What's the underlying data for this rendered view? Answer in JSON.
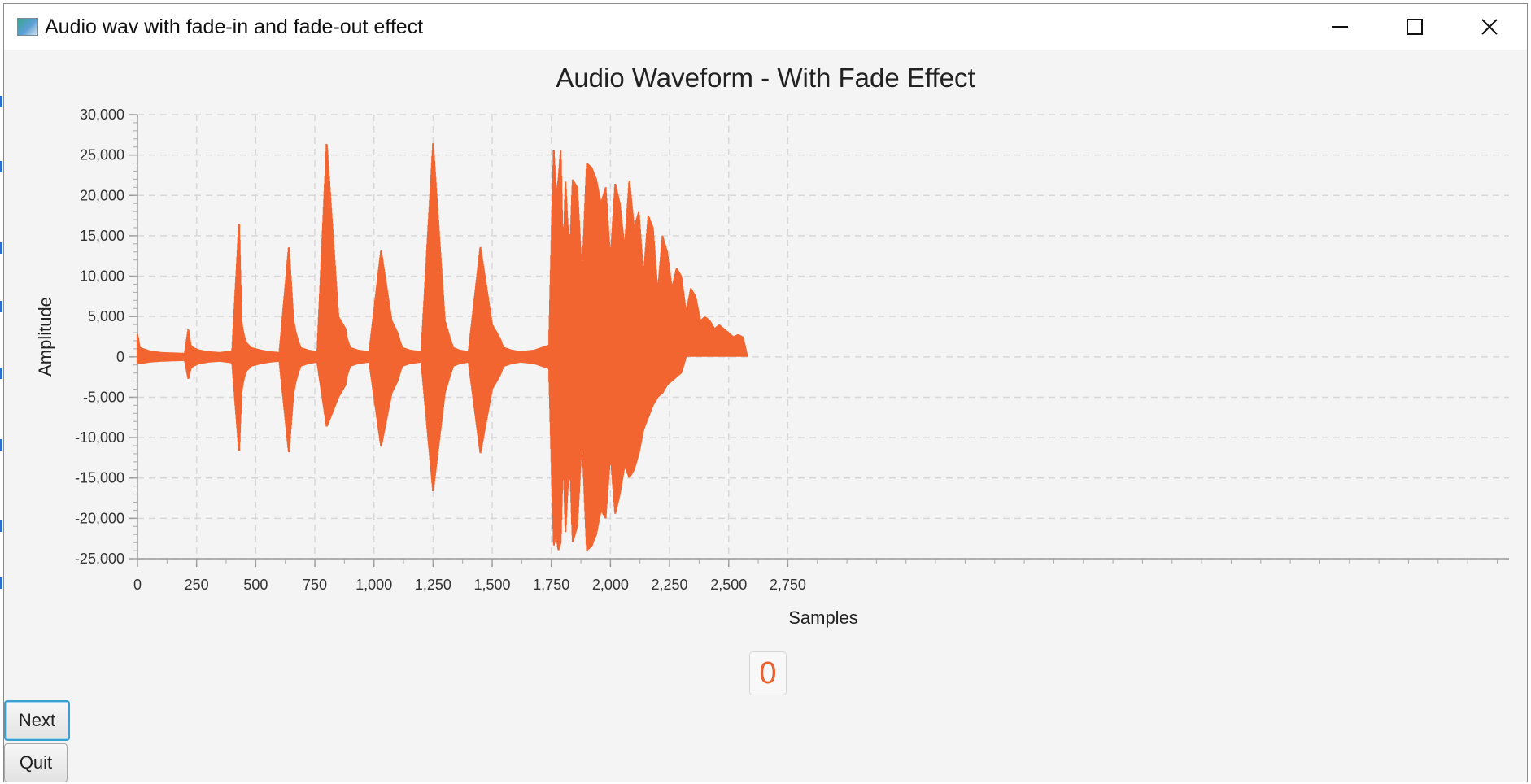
{
  "window": {
    "title": "Audio wav with fade-in and fade-out effect",
    "controls": [
      "minimize-icon",
      "maximize-icon",
      "close-icon"
    ]
  },
  "chart_data": {
    "type": "line",
    "title": "Audio Waveform - With Fade Effect",
    "xlabel": "Samples",
    "ylabel": "Amplitude",
    "xlim": [
      0,
      5800
    ],
    "ylim": [
      -25000,
      30000
    ],
    "x_ticks": [
      "0",
      "250",
      "500",
      "750",
      "1,000",
      "1,250",
      "1,500",
      "1,750",
      "2,000",
      "2,250",
      "2,500",
      "2,750"
    ],
    "y_ticks": [
      "30,000",
      "25,000",
      "20,000",
      "15,000",
      "10,000",
      "5,000",
      "0",
      "-5,000",
      "-10,000",
      "-15,000",
      "-20,000",
      "-25,000"
    ],
    "grid": true,
    "series_color": "#f26430",
    "series": [
      {
        "x": [
          0,
          10,
          50,
          100,
          200,
          215,
          225,
          235,
          260,
          300,
          350,
          400,
          430,
          440,
          445,
          452,
          460,
          480,
          520,
          560,
          600,
          640,
          660,
          670,
          675,
          682,
          690,
          720,
          760,
          800,
          850,
          880,
          885,
          892,
          900,
          930,
          980,
          1030,
          1075,
          1100,
          1105,
          1112,
          1120,
          1150,
          1200,
          1250,
          1300,
          1310,
          1320,
          1328,
          1335,
          1360,
          1400,
          1450,
          1500,
          1520,
          1535,
          1542,
          1550,
          1580,
          1620,
          1680,
          1740,
          1760,
          1770,
          1780,
          1790,
          1800,
          1810,
          1820,
          1830,
          1840,
          1860,
          1880,
          1900,
          1920,
          1940,
          1960,
          1980,
          2000,
          2020,
          2040,
          2060,
          2080,
          2100,
          2120,
          2140,
          2160,
          2180,
          2200,
          2220,
          2240,
          2260,
          2280,
          2300,
          2320,
          2340,
          2360,
          2380,
          2400,
          2420,
          2440,
          2460,
          2480,
          2500,
          2520,
          2540,
          2560,
          2580,
          2600,
          2620,
          2640,
          2650,
          2660,
          2700,
          3000,
          4000,
          5000,
          5800
        ],
        "ymax": [
          2800,
          1200,
          800,
          600,
          500,
          3500,
          1500,
          1200,
          900,
          700,
          600,
          800,
          17000,
          4500,
          3500,
          2500,
          1800,
          1200,
          900,
          700,
          600,
          13800,
          4500,
          3000,
          2500,
          1800,
          1200,
          900,
          700,
          26700,
          5000,
          3500,
          2500,
          1800,
          1200,
          900,
          700,
          13300,
          4500,
          3000,
          2500,
          1800,
          1200,
          900,
          700,
          26700,
          4500,
          3500,
          2500,
          1800,
          1200,
          900,
          700,
          13700,
          4000,
          3000,
          2200,
          1600,
          1200,
          900,
          700,
          900,
          1500,
          26200,
          20000,
          22000,
          25800,
          12000,
          22000,
          16000,
          14000,
          22000,
          21000,
          10000,
          24000,
          23500,
          22000,
          19000,
          21000,
          12000,
          21500,
          19000,
          13500,
          22000,
          16000,
          18000,
          10000,
          17500,
          16000,
          8000,
          15000,
          13000,
          8500,
          11000,
          10000,
          5500,
          8500,
          7500,
          4500,
          5000,
          4500,
          3500,
          4000,
          3500,
          3000,
          2500,
          2800,
          2500,
          0,
          0,
          0,
          0,
          0,
          0,
          0
        ],
        "ymin": [
          -800,
          -900,
          -700,
          -600,
          -500,
          -2800,
          -1500,
          -1200,
          -900,
          -700,
          -600,
          -800,
          -12000,
          -4500,
          -3500,
          -2500,
          -1800,
          -1200,
          -900,
          -700,
          -600,
          -12000,
          -4500,
          -3000,
          -2500,
          -1800,
          -1200,
          -900,
          -700,
          -8700,
          -5000,
          -3500,
          -2500,
          -1800,
          -1200,
          -900,
          -700,
          -11200,
          -4500,
          -3000,
          -2500,
          -1800,
          -1200,
          -900,
          -700,
          -16800,
          -4500,
          -3500,
          -2500,
          -1800,
          -1200,
          -900,
          -700,
          -12000,
          -4000,
          -3000,
          -2200,
          -1600,
          -1200,
          -900,
          -700,
          -900,
          -1500,
          -23500,
          -22000,
          -24000,
          -23000,
          -12000,
          -22000,
          -16000,
          -14000,
          -23000,
          -21000,
          -10000,
          -24000,
          -23500,
          -22000,
          -19000,
          -20000,
          -12000,
          -19500,
          -17000,
          -13500,
          -15000,
          -14000,
          -12000,
          -9000,
          -7500,
          -6000,
          -5000,
          -4500,
          -3500,
          -3000,
          -2500,
          -2000,
          0,
          0,
          0,
          0,
          0,
          0,
          0,
          0,
          0,
          0,
          0,
          0,
          0,
          0,
          0,
          0,
          0,
          0,
          0,
          0,
          0
        ]
      }
    ]
  },
  "counter": {
    "value": "0"
  },
  "buttons": {
    "next": "Next",
    "quit": "Quit"
  }
}
